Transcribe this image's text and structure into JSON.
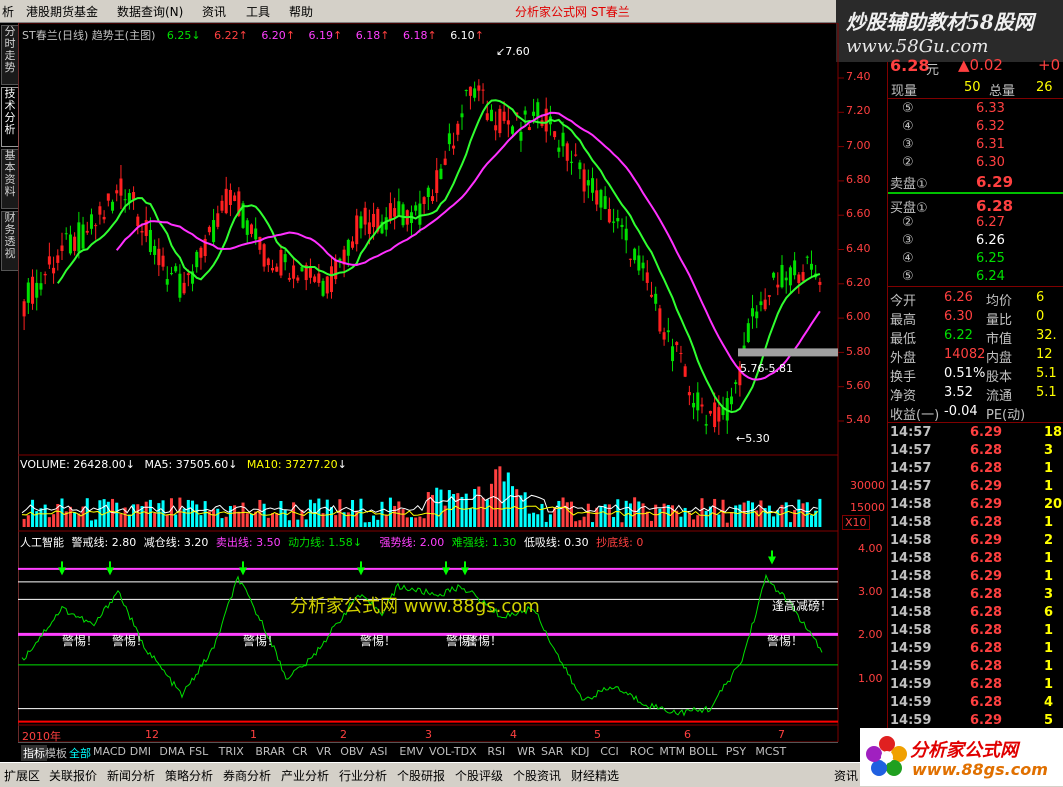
{
  "menu": {
    "items": [
      "析",
      "港股期货基金",
      "数据查询(N)",
      "资讯",
      "工具",
      "帮助"
    ],
    "app_title": "分析家公式网 ST春兰"
  },
  "ad": {
    "line1": "炒股辅助教材58股网",
    "line2": "www.58Gu.com"
  },
  "side_tabs": [
    "分时走势",
    "技术分析",
    "基本资料",
    "财务透视"
  ],
  "main_chart": {
    "header": {
      "name": "ST春兰(日线) 趋势王(主图)",
      "values": [
        "6.25",
        "6.22",
        "6.20",
        "6.19",
        "6.18",
        "6.18",
        "6.10"
      ]
    },
    "y_ticks": [
      "7.40",
      "7.20",
      "7.00",
      "6.80",
      "6.60",
      "6.40",
      "6.20",
      "6.00",
      "5.80",
      "5.60",
      "5.40"
    ],
    "annotations": {
      "high": "7.60",
      "low": "5.30",
      "range": "5.76-5.81"
    }
  },
  "volume": {
    "label": "VOLUME: 26428.00",
    "ma5": "MA5: 37505.60",
    "ma10": "MA10: 37277.20",
    "y_ticks": [
      "30000",
      "15000"
    ],
    "unit": "X10"
  },
  "indicator": {
    "name": "人工智能",
    "params": [
      {
        "label": "警戒线: 2.80",
        "color": "#ffffff"
      },
      {
        "label": "减仓线: 3.20",
        "color": "#ffffff"
      },
      {
        "label": "卖出线: 3.50",
        "color": "#ff40ff"
      },
      {
        "label": "动力线: 1.58",
        "color": "#00e000"
      },
      {
        "label": "强势线: 2.00",
        "color": "#ff40ff"
      },
      {
        "label": "难强线: 1.30",
        "color": "#00e000"
      },
      {
        "label": "低吸线: 0.30",
        "color": "#ffffff"
      },
      {
        "label": "抄底线: 0",
        "color": "#ff0000"
      }
    ],
    "y_ticks": [
      "4.00",
      "3.00",
      "2.00",
      "1.00"
    ],
    "watermark": "分析家公式网 www.88gs.com",
    "warnings": [
      "警惕！",
      "警惕！",
      "警惕！",
      "警惕！",
      "警惕！",
      "警惕！",
      "警惕！"
    ],
    "sell_note": "逢高减磅！"
  },
  "x_axis": {
    "labels": [
      "2010年",
      "12",
      "1",
      "2",
      "3",
      "4",
      "5",
      "6",
      "7"
    ]
  },
  "bottom_tabs": [
    "指标",
    "模板",
    "全部",
    "MACD",
    "DMI",
    "DMA",
    "FSL",
    "TRIX",
    "BRAR",
    "CR",
    "VR",
    "OBV",
    "ASI",
    "EMV",
    "VOL-TDX",
    "RSI",
    "WR",
    "SAR",
    "KDJ",
    "CCI",
    "ROC",
    "MTM",
    "BOLL",
    "PSY",
    "MCST"
  ],
  "taskbar": [
    "扩展区",
    "关联报价",
    "新闻分析",
    "策略分析",
    "券商分析",
    "产业分析",
    "行业分析",
    "个股研报",
    "个股评级",
    "个股资讯",
    "财经精选",
    "资讯"
  ],
  "quote": {
    "price": "6.28",
    "price_unit": "元",
    "change": "▲0.02",
    "change_pct": "+0",
    "xianliang_label": "现量",
    "xianliang": "50",
    "zongliang_label": "总量",
    "zongliang": "26",
    "sell": [
      {
        "level": "⑤",
        "price": "6.33"
      },
      {
        "level": "④",
        "price": "6.32"
      },
      {
        "level": "③",
        "price": "6.31"
      },
      {
        "level": "②",
        "price": "6.30"
      },
      {
        "level": "卖盘①",
        "price": "6.29"
      }
    ],
    "buy": [
      {
        "level": "买盘①",
        "price": "6.28"
      },
      {
        "level": "②",
        "price": "6.27"
      },
      {
        "level": "③",
        "price": "6.26"
      },
      {
        "level": "④",
        "price": "6.25"
      },
      {
        "level": "⑤",
        "price": "6.24"
      }
    ],
    "stats": [
      {
        "l1": "今开",
        "v1": "6.26",
        "l2": "均价",
        "v2": "6"
      },
      {
        "l1": "最高",
        "v1": "6.30",
        "l2": "量比",
        "v2": "0"
      },
      {
        "l1": "最低",
        "v1": "6.22",
        "l2": "市值",
        "v2": "32."
      },
      {
        "l1": "外盘",
        "v1": "14082",
        "l2": "内盘",
        "v2": "12"
      },
      {
        "l1": "换手",
        "v1": "0.51%",
        "l2": "股本",
        "v2": "5.1"
      },
      {
        "l1": "净资",
        "v1": "3.52",
        "l2": "流通",
        "v2": "5.1"
      },
      {
        "l1": "收益(一)",
        "v1": "-0.04",
        "l2": "PE(动)",
        "v2": ""
      }
    ],
    "ticks": [
      {
        "t": "14:57",
        "p": "6.29",
        "v": "18"
      },
      {
        "t": "14:57",
        "p": "6.28",
        "v": "3"
      },
      {
        "t": "14:57",
        "p": "6.28",
        "v": "1"
      },
      {
        "t": "14:57",
        "p": "6.29",
        "v": "1"
      },
      {
        "t": "14:58",
        "p": "6.29",
        "v": "20"
      },
      {
        "t": "14:58",
        "p": "6.28",
        "v": "1"
      },
      {
        "t": "14:58",
        "p": "6.29",
        "v": "2"
      },
      {
        "t": "14:58",
        "p": "6.28",
        "v": "1"
      },
      {
        "t": "14:58",
        "p": "6.29",
        "v": "1"
      },
      {
        "t": "14:58",
        "p": "6.28",
        "v": "3"
      },
      {
        "t": "14:58",
        "p": "6.28",
        "v": "6"
      },
      {
        "t": "14:58",
        "p": "6.28",
        "v": "1"
      },
      {
        "t": "14:59",
        "p": "6.28",
        "v": "1"
      },
      {
        "t": "14:59",
        "p": "6.28",
        "v": "1"
      },
      {
        "t": "14:59",
        "p": "6.28",
        "v": "1"
      },
      {
        "t": "14:59",
        "p": "6.28",
        "v": "4"
      },
      {
        "t": "14:59",
        "p": "6.29",
        "v": "5"
      }
    ]
  },
  "logo": {
    "text": "分析家公式网",
    "url": "www.88gs.com"
  },
  "colors": {
    "up": "#ff2020",
    "down": "#00e000",
    "ma_long": "#ff30ff",
    "ma_short": "#30ff30",
    "grid": "#800000"
  }
}
